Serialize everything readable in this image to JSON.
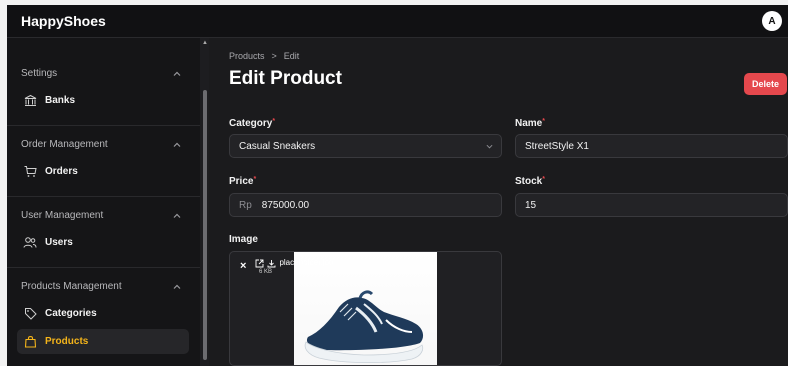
{
  "app": {
    "brand": "HappyShoes",
    "avatar_initial": "A"
  },
  "sidebar": {
    "groups": [
      {
        "label": "Settings",
        "items": [
          {
            "label": "Banks",
            "icon": "bank-icon"
          }
        ]
      },
      {
        "label": "Order Management",
        "items": [
          {
            "label": "Orders",
            "icon": "cart-icon"
          }
        ]
      },
      {
        "label": "User Management",
        "items": [
          {
            "label": "Users",
            "icon": "users-icon"
          }
        ]
      },
      {
        "label": "Products Management",
        "items": [
          {
            "label": "Categories",
            "icon": "tag-icon"
          },
          {
            "label": "Products",
            "icon": "shopping-bag-icon",
            "active": true
          }
        ]
      }
    ]
  },
  "breadcrumb": {
    "parent": "Products",
    "separator": ">",
    "current": "Edit"
  },
  "page": {
    "title": "Edit Product",
    "delete_label": "Delete"
  },
  "form": {
    "category": {
      "label": "Category",
      "required_mark": "*",
      "value": "Casual Sneakers"
    },
    "name": {
      "label": "Name",
      "required_mark": "*",
      "value": "StreetStyle X1"
    },
    "price": {
      "label": "Price",
      "required_mark": "*",
      "prefix": "Rp",
      "value": "875000.00"
    },
    "stock": {
      "label": "Stock",
      "required_mark": "*",
      "value": "15"
    },
    "image": {
      "label": "Image",
      "file_name": "placeholder.jpg",
      "file_size": "6 KB",
      "remove_symbol": "×"
    }
  },
  "colors": {
    "accent": "#f4b41a",
    "danger": "#e5484d",
    "background": "#1b1b1d",
    "sidebar": "#151517"
  }
}
